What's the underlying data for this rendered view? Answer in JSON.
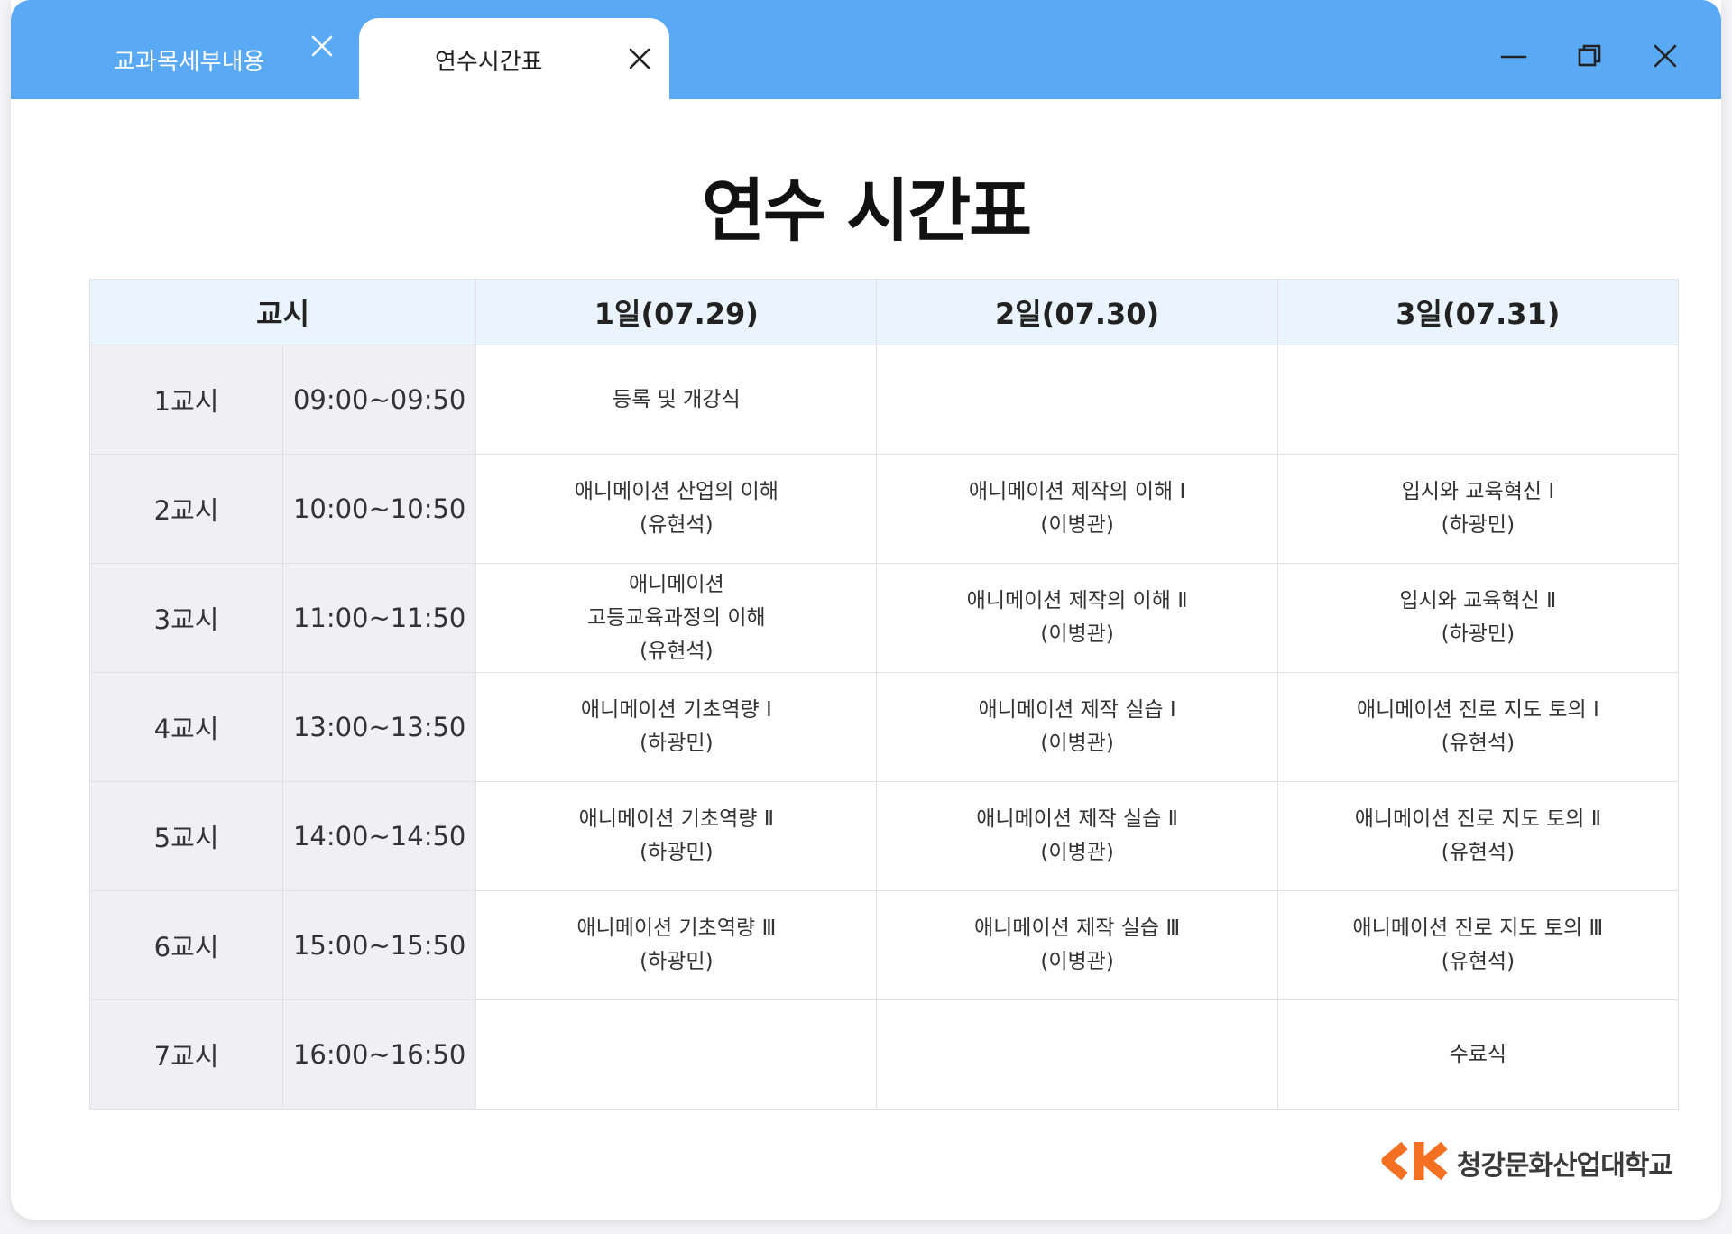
{
  "tabs": [
    {
      "label": "교과목세부내용",
      "active": false
    },
    {
      "label": "연수시간표",
      "active": true
    }
  ],
  "icons": {
    "tab_close": "close-icon",
    "minimize": "minimize-icon",
    "restore": "restore-icon",
    "close": "close-icon"
  },
  "colors": {
    "titlebar": "#5aa9f5",
    "header_bg": "#eaf4fe",
    "period_bg": "#f0eff4",
    "logo_orange": "#f36f21"
  },
  "page": {
    "title": "연수 시간표"
  },
  "table": {
    "columns": [
      "교시",
      "1일(07.29)",
      "2일(07.30)",
      "3일(07.31)"
    ],
    "rows": [
      {
        "period": "1교시",
        "time": "09:00~09:50",
        "day1": [
          "등록 및 개강식"
        ],
        "day2": [],
        "day3": []
      },
      {
        "period": "2교시",
        "time": "10:00~10:50",
        "day1": [
          "애니메이션 산업의 이해",
          "(유현석)"
        ],
        "day2": [
          "애니메이션 제작의 이해 Ⅰ",
          "(이병관)"
        ],
        "day3": [
          "입시와 교육혁신 Ⅰ",
          "(하광민)"
        ]
      },
      {
        "period": "3교시",
        "time": "11:00~11:50",
        "day1": [
          "애니메이션",
          "고등교육과정의 이해",
          "(유현석)"
        ],
        "day2": [
          "애니메이션 제작의 이해 Ⅱ",
          "(이병관)"
        ],
        "day3": [
          "입시와 교육혁신 Ⅱ",
          "(하광민)"
        ]
      },
      {
        "period": "4교시",
        "time": "13:00~13:50",
        "day1": [
          "애니메이션 기초역량 Ⅰ",
          "(하광민)"
        ],
        "day2": [
          "애니메이션 제작 실습 Ⅰ",
          "(이병관)"
        ],
        "day3": [
          "애니메이션 진로 지도 토의 Ⅰ",
          "(유현석)"
        ]
      },
      {
        "period": "5교시",
        "time": "14:00~14:50",
        "day1": [
          "애니메이션 기초역량 Ⅱ",
          "(하광민)"
        ],
        "day2": [
          "애니메이션 제작 실습 Ⅱ",
          "(이병관)"
        ],
        "day3": [
          "애니메이션 진로 지도 토의 Ⅱ",
          "(유현석)"
        ]
      },
      {
        "period": "6교시",
        "time": "15:00~15:50",
        "day1": [
          "애니메이션 기초역량 Ⅲ",
          "(하광민)"
        ],
        "day2": [
          "애니메이션 제작 실습 Ⅲ",
          "(이병관)"
        ],
        "day3": [
          "애니메이션 진로 지도 토의 Ⅲ",
          "(유현석)"
        ]
      },
      {
        "period": "7교시",
        "time": "16:00~16:50",
        "day1": [],
        "day2": [],
        "day3": [
          "수료식"
        ]
      }
    ]
  },
  "footer": {
    "logo_name": "청강문화산업대학교"
  }
}
